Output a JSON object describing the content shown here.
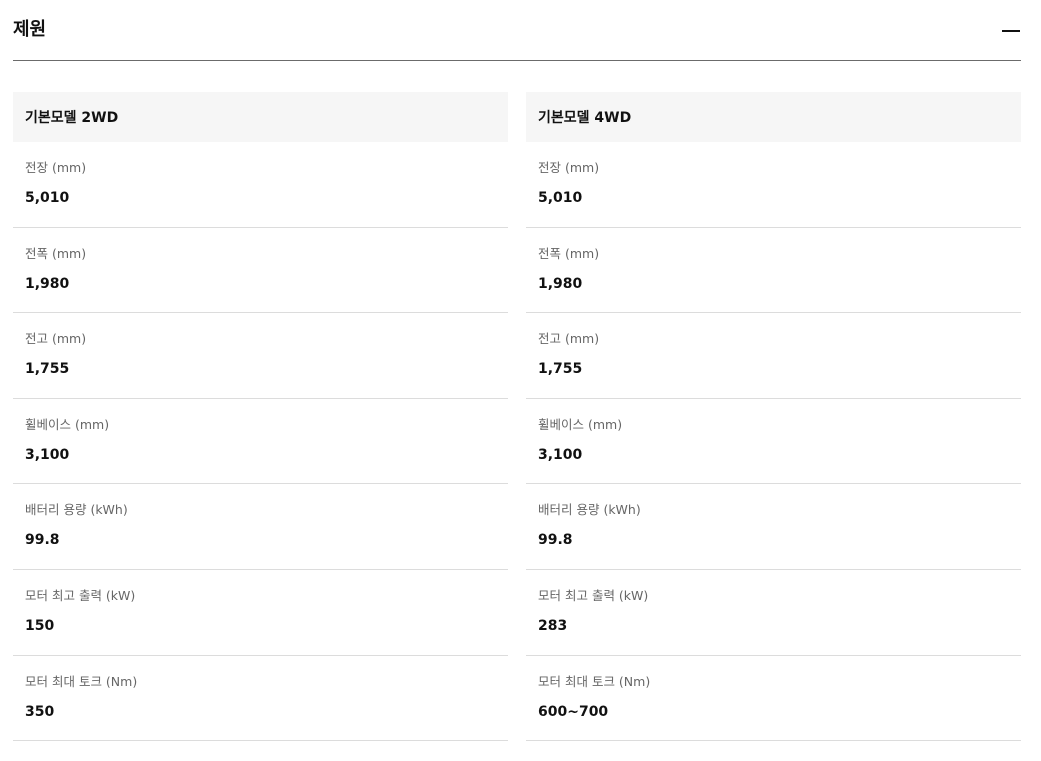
{
  "section": {
    "title": "제원",
    "collapse_icon": "minus-icon"
  },
  "columns": [
    {
      "header": "기본모델 2WD",
      "specs": [
        {
          "label": "전장 (mm)",
          "value": "5,010"
        },
        {
          "label": "전폭 (mm)",
          "value": "1,980"
        },
        {
          "label": "전고 (mm)",
          "value": "1,755"
        },
        {
          "label": "휠베이스 (mm)",
          "value": "3,100"
        },
        {
          "label": "배터리 용량 (kWh)",
          "value": "99.8"
        },
        {
          "label": "모터 최고 출력 (kW)",
          "value": "150"
        },
        {
          "label": "모터 최대 토크 (Nm)",
          "value": "350"
        }
      ]
    },
    {
      "header": "기본모델 4WD",
      "specs": [
        {
          "label": "전장 (mm)",
          "value": "5,010"
        },
        {
          "label": "전폭 (mm)",
          "value": "1,980"
        },
        {
          "label": "전고 (mm)",
          "value": "1,755"
        },
        {
          "label": "휠베이스 (mm)",
          "value": "3,100"
        },
        {
          "label": "배터리 용량 (kWh)",
          "value": "99.8"
        },
        {
          "label": "모터 최고 출력 (kW)",
          "value": "283"
        },
        {
          "label": "모터 최대 토크 (Nm)",
          "value": "600~700"
        }
      ]
    }
  ]
}
